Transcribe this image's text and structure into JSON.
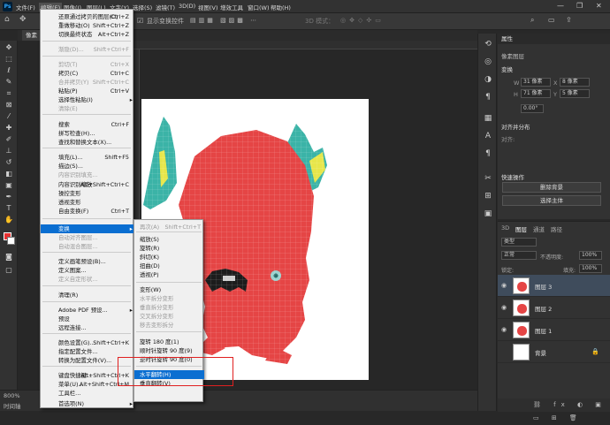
{
  "menubar": {
    "logo": "Ps",
    "items": [
      "文件(F)",
      "编辑(E)",
      "图像(I)",
      "图层(L)",
      "文字(Y)",
      "选择(S)",
      "滤镜(T)",
      "3D(D)",
      "视图(V)",
      "增效工具",
      "窗口(W)",
      "帮助(H)"
    ],
    "window_controls": [
      "—",
      "❐",
      "✕"
    ]
  },
  "options_bar": {
    "show_transform_controls": "显示变换控件",
    "mode_3d": "3D 模式："
  },
  "tab": {
    "label": "像素"
  },
  "edit_menu": {
    "items": [
      {
        "label": "还原通过拷贝的图层(O)",
        "shortcut": "Ctrl+Z",
        "disabled": false
      },
      {
        "label": "重做移动(O)",
        "shortcut": "Shift+Ctrl+Z",
        "disabled": false
      },
      {
        "label": "切换最终状态",
        "shortcut": "Alt+Ctrl+Z",
        "disabled": false
      },
      {
        "label": "渐隐(D)...",
        "shortcut": "Shift+Ctrl+F",
        "disabled": true
      },
      {
        "label": "剪切(T)",
        "shortcut": "Ctrl+X",
        "disabled": true
      },
      {
        "label": "拷贝(C)",
        "shortcut": "Ctrl+C",
        "disabled": false
      },
      {
        "label": "合并拷贝(Y)",
        "shortcut": "Shift+Ctrl+C",
        "disabled": true
      },
      {
        "label": "粘贴(P)",
        "shortcut": "Ctrl+V",
        "disabled": false
      },
      {
        "label": "选择性粘贴(I)",
        "shortcut": "",
        "disabled": false
      },
      {
        "label": "清除(E)",
        "shortcut": "",
        "disabled": true
      },
      {
        "label": "搜索",
        "shortcut": "Ctrl+F",
        "disabled": false
      },
      {
        "label": "拼写检查(H)...",
        "shortcut": "",
        "disabled": false
      },
      {
        "label": "查找和替换文本(X)...",
        "shortcut": "",
        "disabled": false
      },
      {
        "label": "填充(L)...",
        "shortcut": "Shift+F5",
        "disabled": false
      },
      {
        "label": "描边(S)...",
        "shortcut": "",
        "disabled": false
      },
      {
        "label": "内容识别填充...",
        "shortcut": "",
        "disabled": true
      },
      {
        "label": "内容识别缩放",
        "shortcut": "Alt+Shift+Ctrl+C",
        "disabled": false
      },
      {
        "label": "操控变形",
        "shortcut": "",
        "disabled": false
      },
      {
        "label": "透视变形",
        "shortcut": "",
        "disabled": false
      },
      {
        "label": "自由变换(F)",
        "shortcut": "Ctrl+T",
        "disabled": false
      },
      {
        "label": "变换",
        "shortcut": "",
        "disabled": false
      },
      {
        "label": "自动对齐图层...",
        "shortcut": "",
        "disabled": true
      },
      {
        "label": "自动混合图层...",
        "shortcut": "",
        "disabled": true
      },
      {
        "label": "定义画笔预设(B)...",
        "shortcut": "",
        "disabled": false
      },
      {
        "label": "定义图案...",
        "shortcut": "",
        "disabled": false
      },
      {
        "label": "定义自定形状...",
        "shortcut": "",
        "disabled": true
      },
      {
        "label": "清理(R)",
        "shortcut": "",
        "disabled": false
      },
      {
        "label": "Adobe PDF 预设...",
        "shortcut": "",
        "disabled": false
      },
      {
        "label": "预设",
        "shortcut": "",
        "disabled": false
      },
      {
        "label": "远程连接...",
        "shortcut": "",
        "disabled": false
      },
      {
        "label": "颜色设置(G)...",
        "shortcut": "Shift+Ctrl+K",
        "disabled": false
      },
      {
        "label": "指定配置文件...",
        "shortcut": "",
        "disabled": false
      },
      {
        "label": "转换为配置文件(V)...",
        "shortcut": "",
        "disabled": false
      },
      {
        "label": "键盘快捷键...",
        "shortcut": "Alt+Shift+Ctrl+K",
        "disabled": false
      },
      {
        "label": "菜单(U)...",
        "shortcut": "Alt+Shift+Ctrl+M",
        "disabled": false
      },
      {
        "label": "工具栏...",
        "shortcut": "",
        "disabled": false
      },
      {
        "label": "首选项(N)",
        "shortcut": "",
        "disabled": false
      }
    ]
  },
  "transform_menu": {
    "items": [
      {
        "label": "再次(A)",
        "shortcut": "Shift+Ctrl+T",
        "disabled": true
      },
      {
        "label": "缩放(S)",
        "shortcut": "",
        "disabled": false
      },
      {
        "label": "旋转(R)",
        "shortcut": "",
        "disabled": false
      },
      {
        "label": "斜切(K)",
        "shortcut": "",
        "disabled": false
      },
      {
        "label": "扭曲(D)",
        "shortcut": "",
        "disabled": false
      },
      {
        "label": "透视(P)",
        "shortcut": "",
        "disabled": false
      },
      {
        "label": "变形(W)",
        "shortcut": "",
        "disabled": false
      },
      {
        "label": "水平拆分变形",
        "shortcut": "",
        "disabled": true
      },
      {
        "label": "垂直拆分变形",
        "shortcut": "",
        "disabled": true
      },
      {
        "label": "交叉拆分变形",
        "shortcut": "",
        "disabled": true
      },
      {
        "label": "移去变形拆分",
        "shortcut": "",
        "disabled": true
      },
      {
        "label": "旋转 180 度(1)",
        "shortcut": "",
        "disabled": false
      },
      {
        "label": "顺时针旋转 90 度(9)",
        "shortcut": "",
        "disabled": false
      },
      {
        "label": "逆时针旋转 90 度(0)",
        "shortcut": "",
        "disabled": false
      },
      {
        "label": "水平翻转(H)",
        "shortcut": "",
        "disabled": false
      },
      {
        "label": "垂直翻转(V)",
        "shortcut": "",
        "disabled": false
      }
    ]
  },
  "properties": {
    "title": "属性",
    "layer_kind": "像素图层",
    "transform_header": "变换",
    "w_label": "W",
    "w_value": "31 像素",
    "x_label": "X",
    "x_value": "8 像素",
    "h_label": "H",
    "h_value": "71 像素",
    "y_label": "Y",
    "y_value": "5 像素",
    "angle_value": "0.00°",
    "align_header": "对齐并分布",
    "align_label": "对齐:",
    "quick_header": "快速操作",
    "remove_bg": "删除背景",
    "select_subject": "选择主体"
  },
  "layers_panel": {
    "tabs": [
      "3D",
      "图层",
      "通道",
      "路径"
    ],
    "filter_kind": "类型",
    "blend_mode": "正常",
    "opacity_label": "不透明度:",
    "opacity_value": "100%",
    "lock_label": "锁定:",
    "fill_label": "填充:",
    "fill_value": "100%",
    "layers": [
      {
        "name": "图层 3",
        "selected": true
      },
      {
        "name": "图层 2",
        "selected": false
      },
      {
        "name": "图层 1",
        "selected": false
      },
      {
        "name": "背景",
        "selected": false
      }
    ]
  },
  "status": {
    "zoom": "800%",
    "timeline": "时间轴"
  },
  "colors": {
    "accent": "#0a6ed1",
    "character": "#e54545",
    "horn": "#3bb3a7",
    "highlight_box": "#e02020"
  }
}
